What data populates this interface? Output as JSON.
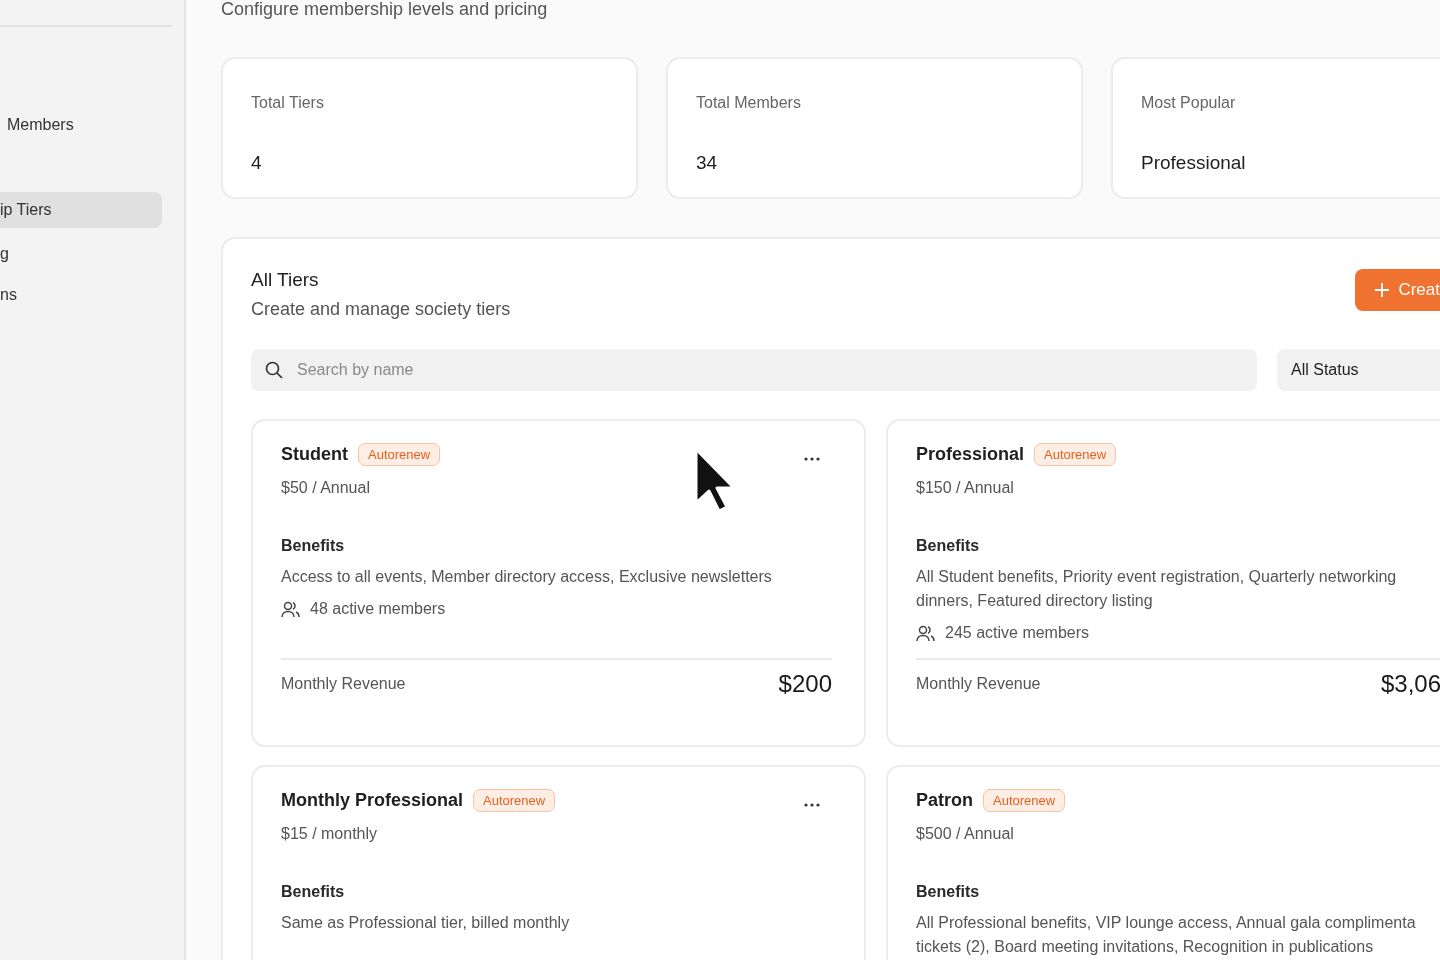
{
  "sidebar": {
    "items": [
      {
        "label": "Members",
        "selected": false
      },
      {
        "label": "ip Tiers",
        "selected": true
      },
      {
        "label": "g",
        "selected": false
      },
      {
        "label": "ns",
        "selected": false
      }
    ]
  },
  "header": {
    "subtitle": "Configure membership levels and pricing"
  },
  "stats": [
    {
      "label": "Total Tiers",
      "value": "4"
    },
    {
      "label": "Total Members",
      "value": "34"
    },
    {
      "label": "Most Popular",
      "value": "Professional"
    }
  ],
  "tiers_panel": {
    "title": "All Tiers",
    "subtitle": "Create and manage society tiers",
    "create_button": "Creat",
    "search": {
      "placeholder": "Search by name"
    },
    "status_filter": "All Status",
    "tiers": [
      {
        "name": "Student",
        "badge": "Autorenew",
        "price": "$50 / Annual",
        "benefits_heading": "Benefits",
        "benefits": [
          "Access to all events, Member directory access, Exclusive newsletters"
        ],
        "members": "48 active members",
        "revenue_label": "Monthly Revenue",
        "revenue": "$200"
      },
      {
        "name": "Professional",
        "badge": "Autorenew",
        "price": "$150 / Annual",
        "benefits_heading": "Benefits",
        "benefits": [
          "All Student benefits, Priority event registration, Quarterly networking",
          "dinners, Featured directory listing"
        ],
        "members": "245 active members",
        "revenue_label": "Monthly Revenue",
        "revenue": "$3,06"
      },
      {
        "name": "Monthly Professional",
        "badge": "Autorenew",
        "price": "$15 / monthly",
        "benefits_heading": "Benefits",
        "benefits": [
          "Same as Professional tier, billed monthly"
        ]
      },
      {
        "name": "Patron",
        "badge": "Autorenew",
        "price": "$500 / Annual",
        "benefits_heading": "Benefits",
        "benefits": [
          "All Professional benefits, VIP lounge access, Annual gala complimenta",
          "tickets (2), Board meeting invitations, Recognition in publications"
        ]
      }
    ]
  }
}
